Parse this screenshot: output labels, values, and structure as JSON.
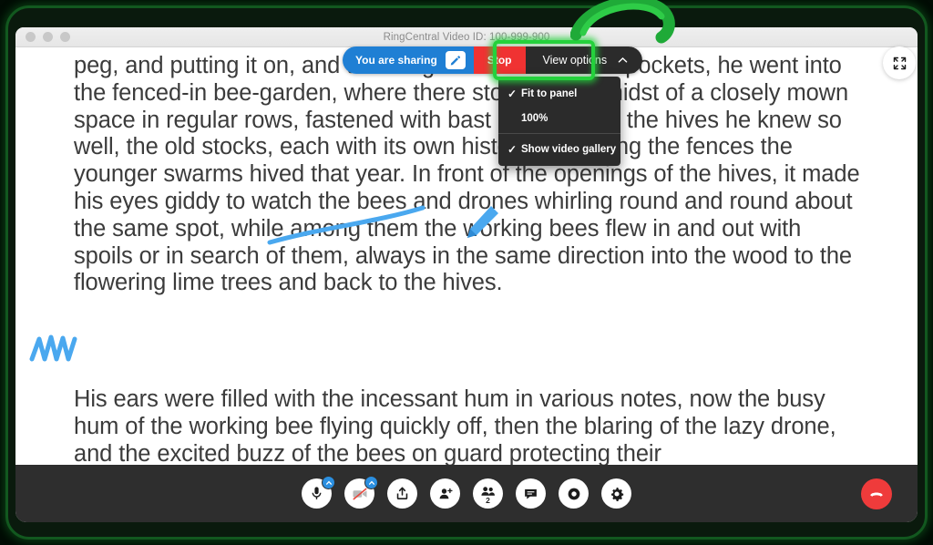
{
  "window": {
    "title": "RingCentral Video ID: 100-999-900",
    "traffic_lights": [
      "close",
      "minimize",
      "maximize"
    ]
  },
  "document": {
    "paragraph_1": "peg, and putting it on, and thrusting his hands into his pockets, he went into the fenced-in bee-garden, where there stood, in the midst of a closely mown space in regular rows, fastened with bast on posts, all the hives he knew so well, the old stocks, each with its own history, and along the fences the younger swarms hived that year. In front of the openings of the hives, it made his eyes giddy to watch the bees and drones whirling round and round about the same spot, while among them the working bees flew in and out with spoils or in search of them, always in the same direction into the wood to the flowering lime trees and back to the hives.",
    "paragraph_2": "His ears were filled with the incessant hum in various notes, now the busy hum of the working bee flying quickly off, then the blaring of the lazy drone, and the excited buzz of the bees on guard protecting their"
  },
  "share_bar": {
    "sharing_label": "You are sharing",
    "annotate_icon": "pencil-icon",
    "stop_label": "Stop",
    "view_options_label": "View options",
    "view_options_chevron": "chevron-up-icon"
  },
  "view_options_menu": {
    "items": [
      {
        "label": "Fit to panel",
        "checked": true
      },
      {
        "label": "100%",
        "checked": false
      },
      {
        "label": "Show video gallery",
        "checked": true
      }
    ]
  },
  "fullscreen_button": {
    "icon": "expand-icon"
  },
  "annotations": {
    "highlight_color": "#24d13c",
    "arrow_color": "#1faa38",
    "ink_color": "#4aa8ef",
    "ink_marks": [
      "underline-stroke",
      "scribble-strikethrough"
    ],
    "cursor": "pen-cursor"
  },
  "toolbar": {
    "buttons": [
      {
        "name": "microphone",
        "icon": "microphone-icon",
        "badge": "chevron-up-icon"
      },
      {
        "name": "video",
        "icon": "video-off-icon",
        "badge": "chevron-up-icon"
      },
      {
        "name": "share-screen",
        "icon": "share-upload-icon"
      },
      {
        "name": "invite",
        "icon": "add-person-icon"
      },
      {
        "name": "participants",
        "icon": "people-icon",
        "count": "2"
      },
      {
        "name": "chat",
        "icon": "chat-bubble-icon"
      },
      {
        "name": "record",
        "icon": "record-circle-icon"
      },
      {
        "name": "settings",
        "icon": "gear-icon"
      }
    ],
    "hangup": {
      "name": "end-call",
      "icon": "phone-hangup-icon",
      "color": "#ef3b3b"
    }
  }
}
